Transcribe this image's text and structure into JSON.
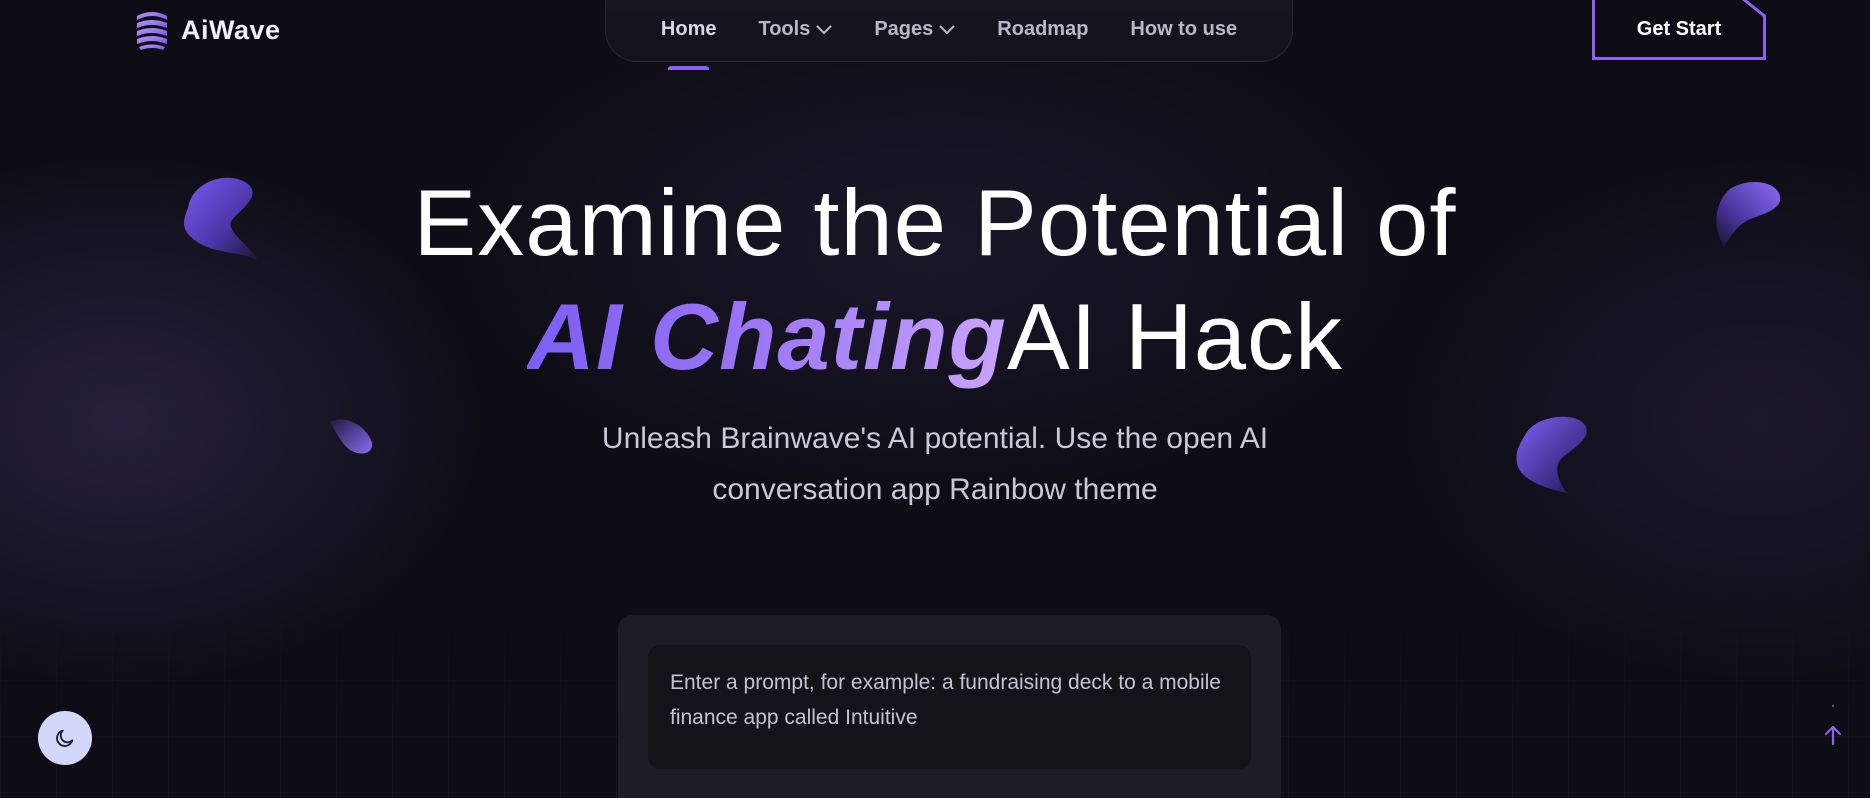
{
  "brand": {
    "name": "AiWave",
    "icon": "layered-stack-logo-icon",
    "accent_color": "#8a63f0"
  },
  "nav": {
    "items": [
      {
        "label": "Home",
        "active": true,
        "has_dropdown": false
      },
      {
        "label": "Tools",
        "active": false,
        "has_dropdown": true
      },
      {
        "label": "Pages",
        "active": false,
        "has_dropdown": true
      },
      {
        "label": "Roadmap",
        "active": false,
        "has_dropdown": false
      },
      {
        "label": "How to use",
        "active": false,
        "has_dropdown": false
      }
    ]
  },
  "cta": {
    "label": "Get Start",
    "border_color": "#8a63f0"
  },
  "hero": {
    "line1": "Examine the Potential of",
    "accent": "AI Chating",
    "rotating": "AI Hack",
    "subtitle": "Unleash Brainwave's AI potential. Use the open AI conversation app Rainbow theme"
  },
  "prompt": {
    "text": "Enter a prompt, for example: a fundraising deck to a mobile finance app called Intuitive"
  },
  "controls": {
    "theme_toggle_icon": "moon-icon",
    "scroll_top_icon": "arrow-up-icon"
  },
  "colors": {
    "background": "#0e0d16",
    "accent_gradient_start": "#7c5ef5",
    "accent_gradient_end": "#c9a4fb",
    "toggle_bg": "#d3d7fa"
  }
}
